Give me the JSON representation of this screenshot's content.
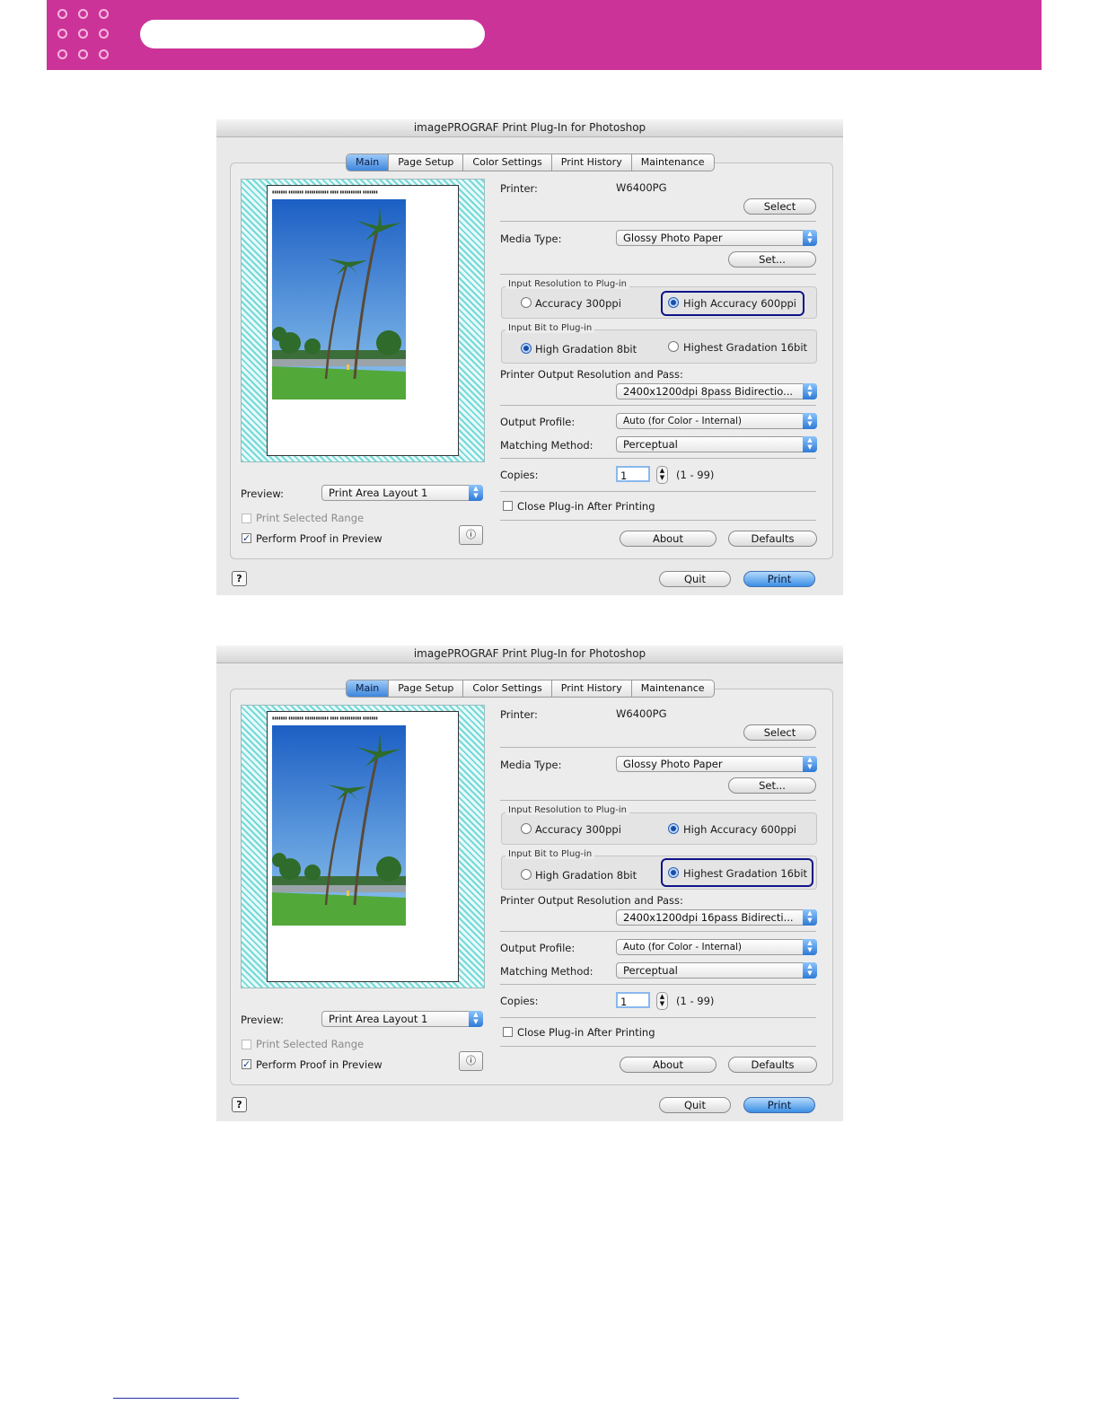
{
  "windows": [
    {
      "title": "imagePROGRAF Print Plug-In for Photoshop",
      "tabs": [
        "Main",
        "Page Setup",
        "Color Settings",
        "Print History",
        "Maintenance"
      ],
      "active_tab": "Main",
      "printer_label": "Printer:",
      "printer_value": "W6400PG",
      "select_label": "Select",
      "media_type_label": "Media Type:",
      "media_type_value": "Glossy Photo Paper",
      "set_label": "Set...",
      "input_res_group": "Input Resolution to Plug-in",
      "res_option_1": "Accuracy 300ppi",
      "res_option_2": "High Accuracy 600ppi",
      "res_selected": 2,
      "input_bit_group": "Input Bit to Plug-in",
      "bit_option_1": "High Gradation 8bit",
      "bit_option_2": "Highest Gradation 16bit",
      "bit_selected": 1,
      "highlight": "resolution",
      "output_res_label": "Printer Output Resolution and Pass:",
      "output_res_value": "2400x1200dpi 8pass Bidirectio...",
      "output_profile_label": "Output Profile:",
      "output_profile_value": "Auto (for Color - Internal)",
      "matching_label": "Matching Method:",
      "matching_value": "Perceptual",
      "copies_label": "Copies:",
      "copies_value": "1",
      "copies_range": "(1 - 99)",
      "close_after_label": "Close Plug-in After Printing",
      "close_after_checked": false,
      "about_label": "About",
      "defaults_label": "Defaults",
      "preview_label": "Preview:",
      "preview_value": "Print Area Layout 1",
      "print_selected_label": "Print Selected Range",
      "print_selected_checked": false,
      "perform_proof_label": "Perform Proof in Preview",
      "perform_proof_checked": true,
      "quit_label": "Quit",
      "print_label": "Print"
    },
    {
      "title": "imagePROGRAF Print Plug-In for Photoshop",
      "tabs": [
        "Main",
        "Page Setup",
        "Color Settings",
        "Print History",
        "Maintenance"
      ],
      "active_tab": "Main",
      "printer_label": "Printer:",
      "printer_value": "W6400PG",
      "select_label": "Select",
      "media_type_label": "Media Type:",
      "media_type_value": "Glossy Photo Paper",
      "set_label": "Set...",
      "input_res_group": "Input Resolution to Plug-in",
      "res_option_1": "Accuracy 300ppi",
      "res_option_2": "High Accuracy 600ppi",
      "res_selected": 2,
      "input_bit_group": "Input Bit to Plug-in",
      "bit_option_1": "High Gradation 8bit",
      "bit_option_2": "Highest Gradation 16bit",
      "bit_selected": 2,
      "highlight": "bit",
      "output_res_label": "Printer Output Resolution and Pass:",
      "output_res_value": "2400x1200dpi 16pass Bidirecti...",
      "output_profile_label": "Output Profile:",
      "output_profile_value": "Auto (for Color - Internal)",
      "matching_label": "Matching Method:",
      "matching_value": "Perceptual",
      "copies_label": "Copies:",
      "copies_value": "1",
      "copies_range": "(1 - 99)",
      "close_after_label": "Close Plug-in After Printing",
      "close_after_checked": false,
      "about_label": "About",
      "defaults_label": "Defaults",
      "preview_label": "Preview:",
      "preview_value": "Print Area Layout 1",
      "print_selected_label": "Print Selected Range",
      "print_selected_checked": false,
      "perform_proof_label": "Perform Proof in Preview",
      "perform_proof_checked": true,
      "quit_label": "Quit",
      "print_label": "Print"
    }
  ],
  "colors": {
    "banner": "#cc3399",
    "highlight_border": "#10148a",
    "print_button": "#3b8fe4"
  }
}
